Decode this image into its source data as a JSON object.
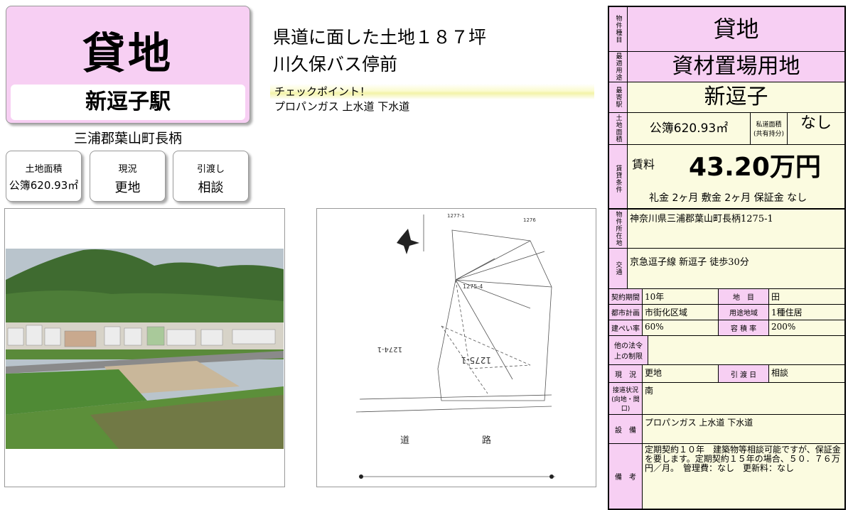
{
  "title": "貸地",
  "station": "新逗子駅",
  "address_short": "三浦郡葉山町長柄",
  "summary_boxes": [
    {
      "label": "土地面積",
      "value": "公簿620.93㎡"
    },
    {
      "label": "現況",
      "value": "更地"
    },
    {
      "label": "引渡し",
      "value": "相談"
    }
  ],
  "headline": [
    "県道に面した土地１８７坪",
    "川久保バス停前"
  ],
  "checkpoint_label": "チェックポイント！",
  "utilities_line": "プロパンガス 上水道 下水道",
  "map": {
    "road_label_1": "道",
    "road_label_2": "路",
    "lot_main": "1275-1",
    "lot_side": "1274-1",
    "lot_upper": "1275-4",
    "top_a": "1277-1",
    "top_b": "1276"
  },
  "details": {
    "type_label": "物件種目",
    "type_value": "貸地",
    "use_label": "最適用途",
    "use_value": "資材置場用地",
    "station_label": "最寄駅",
    "station_value": "新逗子",
    "area_label": "土地面積",
    "area_value": "公簿620.93㎡",
    "private_road_label": "私道面積",
    "private_road_sub": "(共有持分)",
    "private_road_value": "なし",
    "rent_label": "賃貸条件",
    "rent_caption": "賃料",
    "rent_value": "43.20万円",
    "terms": "礼金 2ヶ月  敷金 2ヶ月  保証金 なし"
  },
  "info": {
    "location_label": "物件所在地",
    "location_value": "神奈川県三浦郡葉山町長柄1275-1",
    "transport_label": "交通",
    "transport_value": "京急逗子線 新逗子 徒歩30分",
    "contract_label": "契約期間",
    "contract_value": "10年",
    "land_cat_label": "地　目",
    "land_cat_value": "田",
    "city_plan_label": "都市計画",
    "city_plan_value": "市街化区域",
    "zoning_label": "用途地域",
    "zoning_value": "1種住居",
    "bcr_label": "建ぺい率",
    "bcr_value": "60%",
    "far_label": "容 積 率",
    "far_value": "200%",
    "law_label": "他の法令上の制限",
    "law_value": "",
    "status_label": "現　況",
    "status_value": "更地",
    "handover_label": "引 渡 日",
    "handover_value": "相談",
    "road_label": "接道状況",
    "road_sub": "(向地・間口)",
    "road_value": "南",
    "facility_label": "設　備",
    "facility_value": "プロパンガス 上水道 下水道",
    "remarks_label": "備　考",
    "remarks_value": "定期契約１０年　建築物等相談可能ですが、保証金を要します。定期契約１５年の場合、５０．７６万円／月。　管理費：なし　更新料：なし"
  },
  "colors": {
    "pink": "#f7cff3",
    "yellow": "#fbfbe0"
  }
}
